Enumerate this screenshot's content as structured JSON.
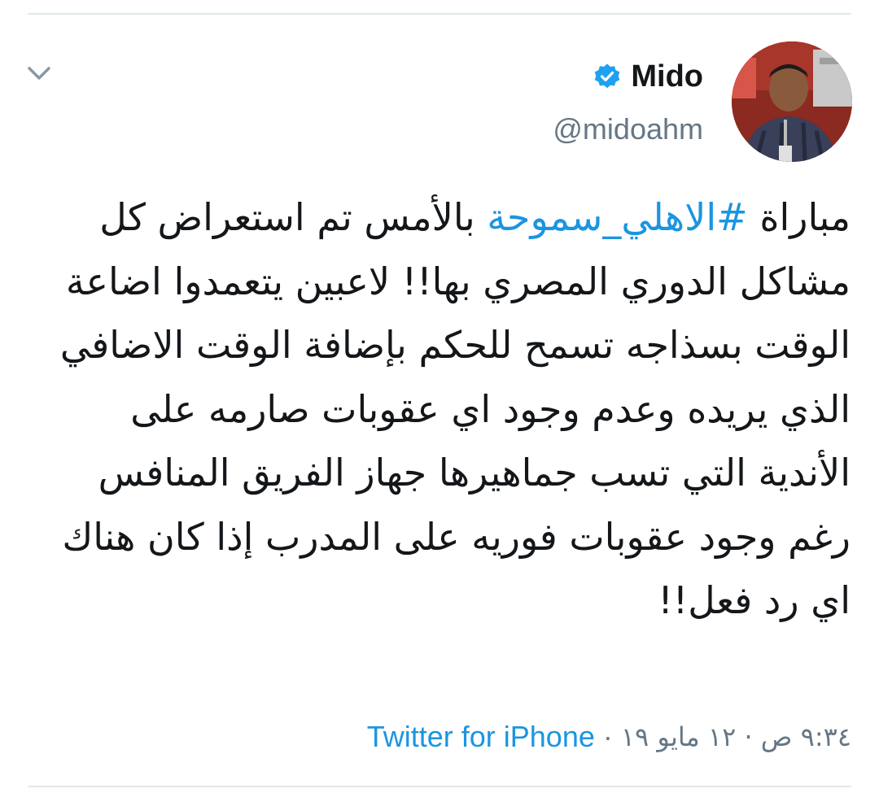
{
  "tweet": {
    "author": {
      "display_name": "Mido",
      "handle": "@midoahm",
      "verified": true,
      "avatar_icon": "profile-photo"
    },
    "text_parts": {
      "before_hashtag": "مباراة ",
      "hashtag": "#الاهلي_سموحة",
      "after_hashtag": " بالأمس تم استعراض كل مشاكل الدوري المصري بها!! لاعبين يتعمدوا اضاعة الوقت بسذاجه تسمح للحكم بإضافة الوقت الاضافي الذي يريده وعدم وجود اي عقوبات صارمه على الأندية التي تسب جماهيرها جهاز الفريق المنافس رغم وجود عقوبات فوريه على المدرب إذا كان هناك اي رد فعل!!"
    },
    "timestamp": "٩:٣٤ ص · ١٢ مايو ١٩",
    "separator": "·",
    "source": "Twitter for iPhone"
  },
  "icons": {
    "caret": "chevron-down-icon",
    "verified": "verified-badge-icon"
  },
  "colors": {
    "link": "#1b95e0",
    "text": "#14171a",
    "secondary": "#657786",
    "divider": "#e1e8ed"
  }
}
